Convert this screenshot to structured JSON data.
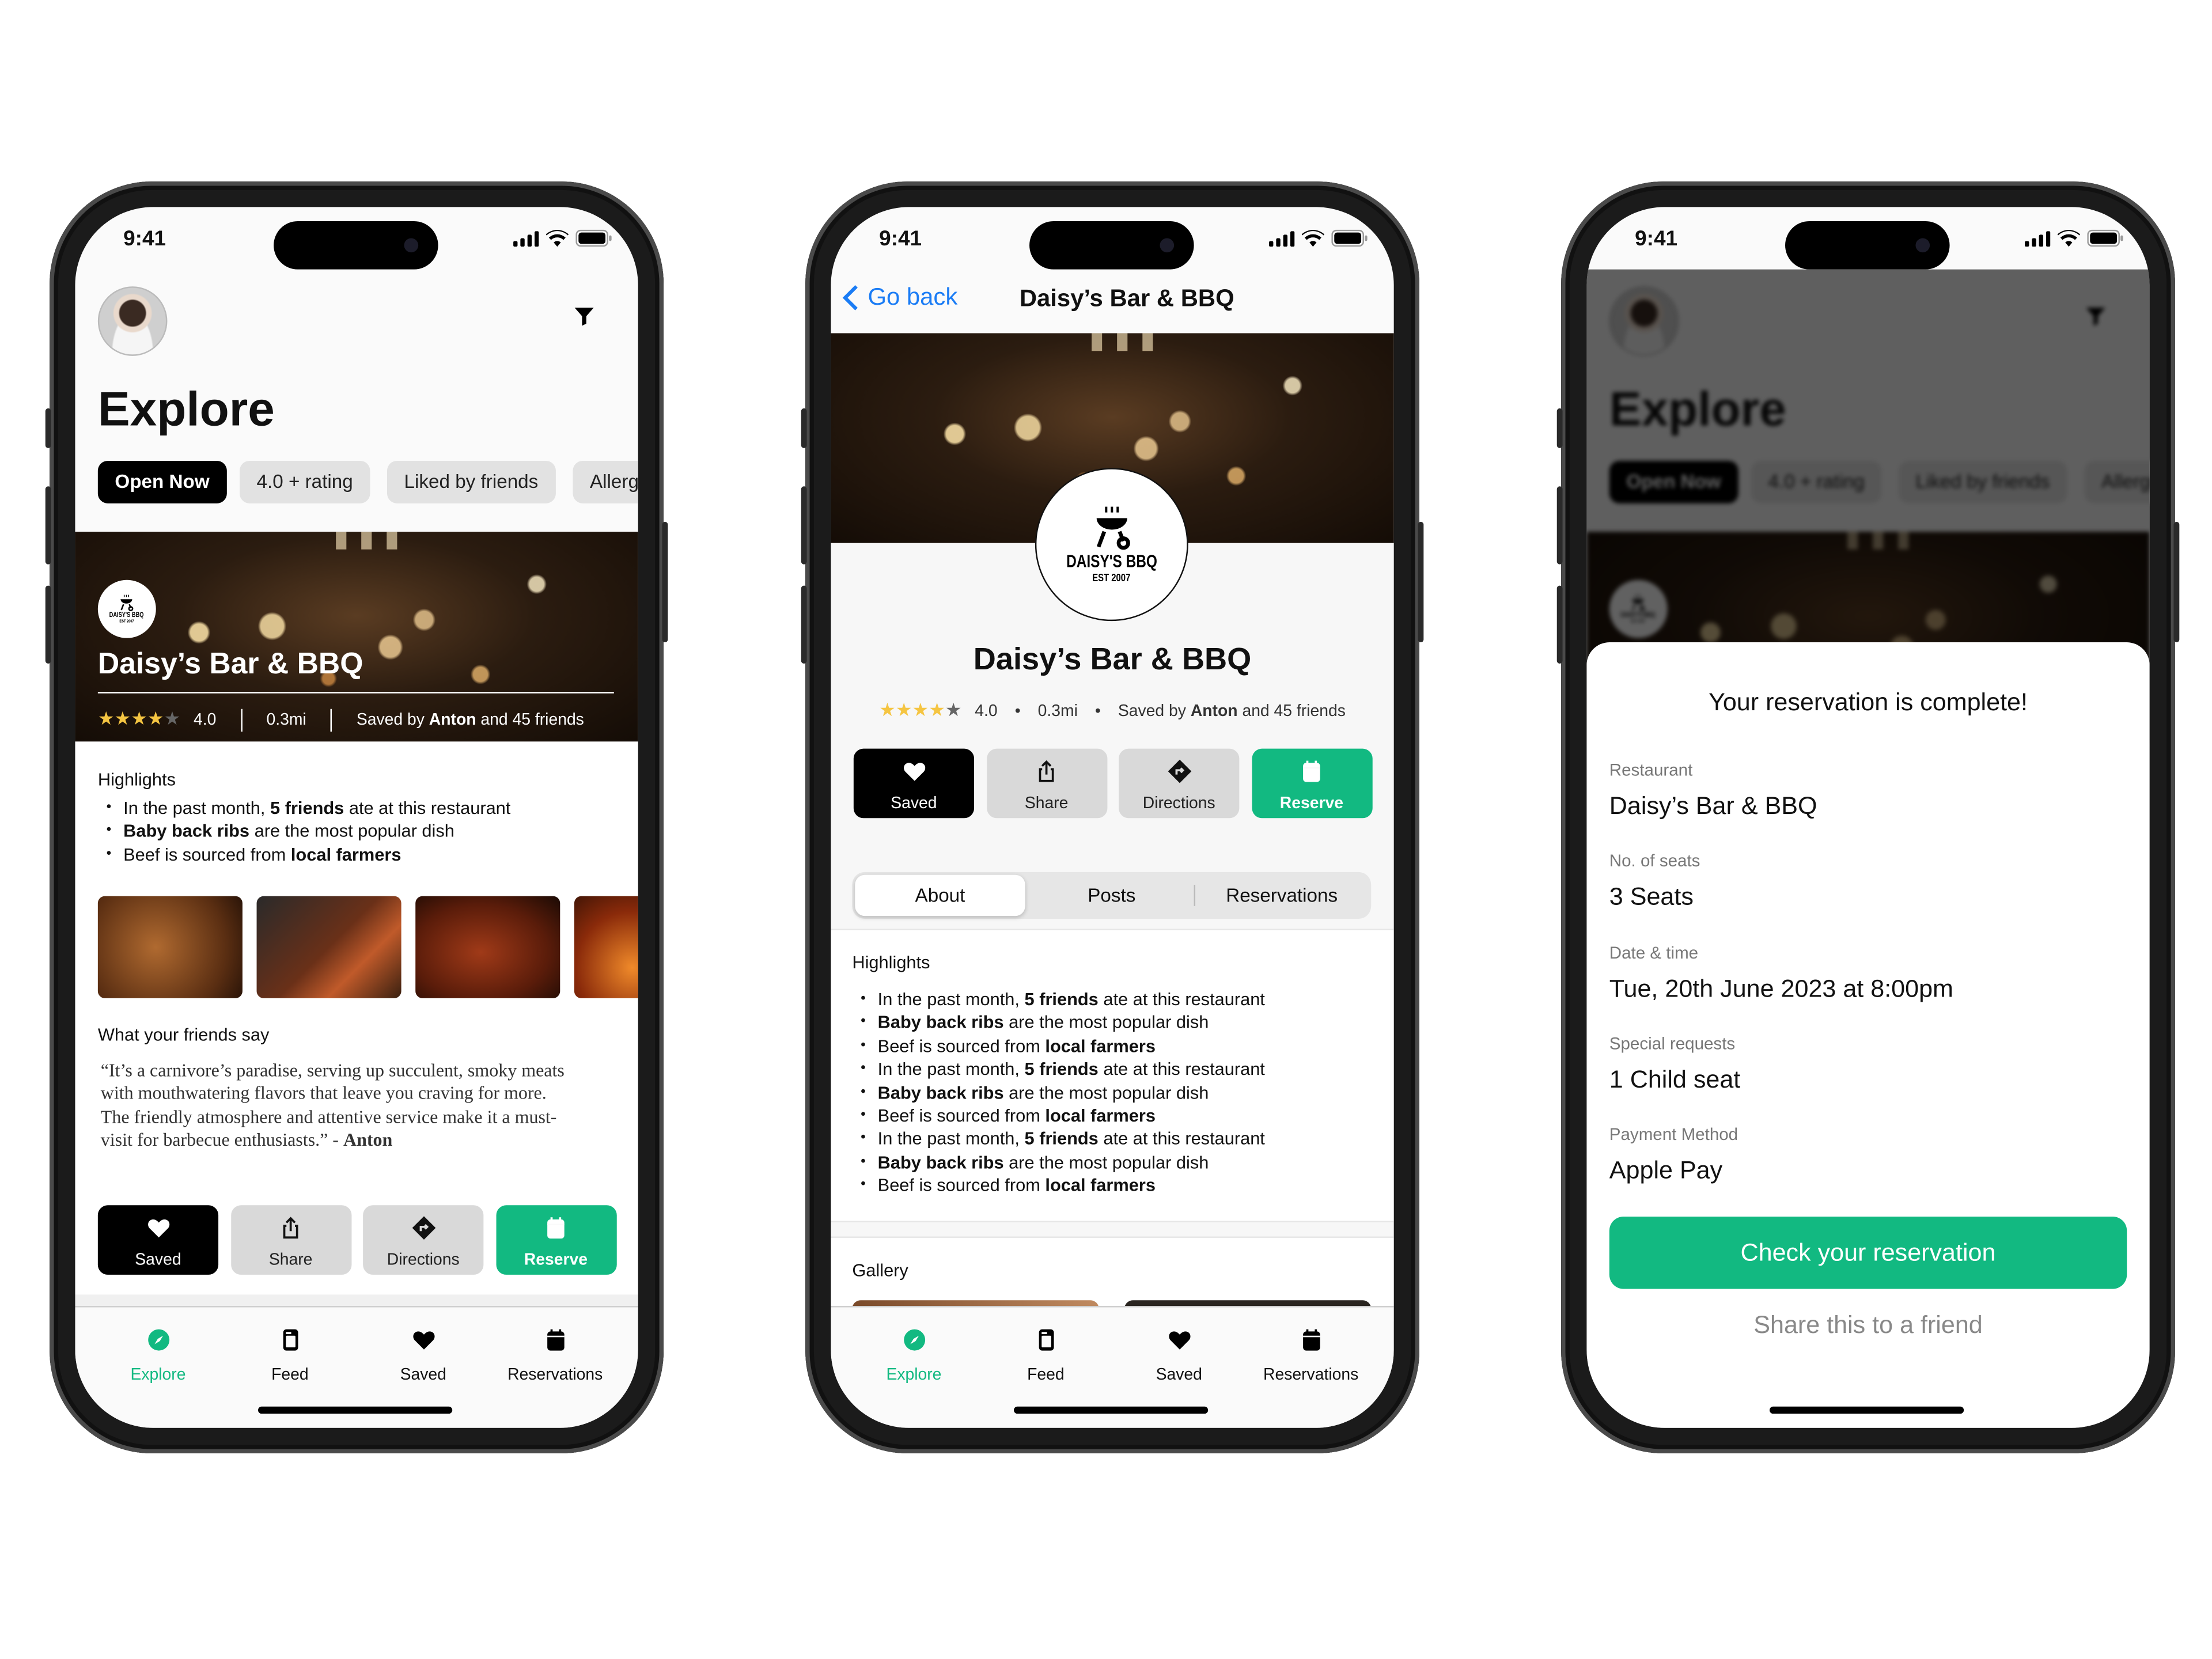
{
  "colors": {
    "accent": "#12b981",
    "link": "#1a7cf5",
    "black": "#000000"
  },
  "status": {
    "time": "9:41"
  },
  "restaurant": {
    "name": "Daisy’s Bar & BBQ",
    "logo_text": "DAISY'S BBQ",
    "logo_est": "EST 2007",
    "rating": "4.0",
    "rating_value": 4,
    "rating_max": 5,
    "distance": "0.3mi",
    "saved_by_prefix": "Saved by ",
    "saved_by_name": "Anton",
    "saved_by_suffix": " and 45 friends"
  },
  "highlights": {
    "title": "Highlights",
    "items": [
      {
        "pre": "In the past month, ",
        "bold": "5 friends",
        "post": " ate at this restaurant"
      },
      {
        "pre": "",
        "bold": "Baby back ribs",
        "post": " are the most popular dish"
      },
      {
        "pre": "Beef is sourced from ",
        "bold": "local farmers",
        "post": ""
      }
    ]
  },
  "explore": {
    "title": "Explore",
    "avatar_icon": "user-avatar",
    "filter_icon": "filter-icon",
    "chips": [
      "Open Now",
      "4.0 + rating",
      "Liked by friends",
      "Allergies"
    ],
    "friends_title": "What your friends say",
    "quote": "“It’s a carnivore’s paradise, serving up succulent, smoky meats with mouthwatering flavors that leave you craving for more. The friendly atmosphere and attentive service make it a must-visit for barbecue enthusiasts.” - ",
    "quote_author": "Anton"
  },
  "actions": [
    {
      "label": "Saved",
      "icon": "heart-icon"
    },
    {
      "label": "Share",
      "icon": "share-icon"
    },
    {
      "label": "Directions",
      "icon": "directions-icon"
    },
    {
      "label": "Reserve",
      "icon": "calendar-icon"
    }
  ],
  "tabbar": [
    {
      "label": "Explore",
      "icon": "compass-icon",
      "active": true
    },
    {
      "label": "Feed",
      "icon": "feed-icon"
    },
    {
      "label": "Saved",
      "icon": "heart-icon"
    },
    {
      "label": "Reservations",
      "icon": "calendar-icon"
    }
  ],
  "detail": {
    "back": "Go back",
    "segments": [
      "About",
      "Posts",
      "Reservations"
    ],
    "selected_segment": "About",
    "gallery_title": "Gallery"
  },
  "confirmation": {
    "title": "Your reservation is complete!",
    "fields": [
      {
        "label": "Restaurant",
        "value": "Daisy’s Bar & BBQ"
      },
      {
        "label": "No. of seats",
        "value": "3 Seats"
      },
      {
        "label": "Date & time",
        "value": "Tue, 20th June 2023 at 8:00pm"
      },
      {
        "label": "Special requests",
        "value": "1 Child seat"
      },
      {
        "label": "Payment Method",
        "value": "Apple Pay"
      }
    ],
    "primary": "Check your reservation",
    "secondary": "Share this to a friend"
  }
}
